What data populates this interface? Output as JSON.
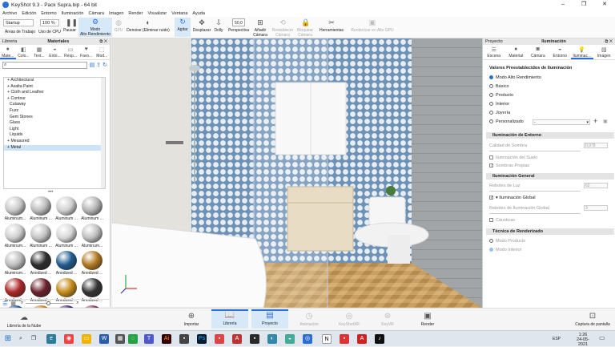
{
  "window": {
    "title": "KeyShot 9.3 - Pack Supra.bip - 64 bit"
  },
  "menu": [
    "Archivo",
    "Edición",
    "Entorno",
    "Iluminación",
    "Cámara",
    "Imagen",
    "Render",
    "Visualizar",
    "Ventana",
    "Ayuda"
  ],
  "toolbar": {
    "workspace": "Startup",
    "zoom": "100 %",
    "workspace_label": "Áreas de Trabajo",
    "cpu_label": "Uso de CPU",
    "pause_label": "Pausar",
    "modo_label": "Modo\nAlto Rendimiento",
    "gpu_label": "GPU",
    "denoise_label": "Denoise (Eliminar ruido)",
    "agitar_label": "Agitar",
    "desplazar_label": "Desplazar",
    "dolly_label": "Dolly",
    "perspective_value": "50,0",
    "perspective_label": "Perspectiva",
    "add_camera_label": "Añadir\nCámara",
    "reset_camera_label": "Restablecer\nCámara",
    "lock_camera_label": "Bloquear\nCámara",
    "tools_label": "Herramientas",
    "render_hp_label": "Renderizar en Alto GPU"
  },
  "library": {
    "panel_title": "Libreria",
    "section_title": "Materiales",
    "tabs": [
      "Mate...",
      "Colo...",
      "Text...",
      "Ento...",
      "Resp...",
      "Favo...",
      "Mod..."
    ],
    "tree": [
      "Architectural",
      "Axalta Paint",
      "Cloth and Leather",
      "Contour",
      "Cutaway",
      "Fuzz",
      "Gem Stones",
      "Glass",
      "Light",
      "Liquids",
      "Measured",
      "Metal"
    ],
    "selected": "Metal",
    "tiles": [
      {
        "label": "Aluminum...",
        "color": "#c9c9c9"
      },
      {
        "label": "Aluminum ...",
        "color": "#bcbcbc"
      },
      {
        "label": "Aluminum ...",
        "color": "#d0d0d0"
      },
      {
        "label": "Aluminum ...",
        "color": "#b5b5b5"
      },
      {
        "label": "Aluminum...",
        "color": "#cfcfcf"
      },
      {
        "label": "Aluminum ...",
        "color": "#c5c5c5"
      },
      {
        "label": "Aluminum ...",
        "color": "#d8d8d8"
      },
      {
        "label": "Aluminum...",
        "color": "#c0c0c0"
      },
      {
        "label": "Aluminum...",
        "color": "#bdbdbd"
      },
      {
        "label": "Anodized ...",
        "color": "#2b2b2b"
      },
      {
        "label": "Anodized ...",
        "color": "#1f5b8f"
      },
      {
        "label": "Anodized ...",
        "color": "#b07820"
      },
      {
        "label": "Anodized ...",
        "color": "#aa2626"
      },
      {
        "label": "Anodized ...",
        "color": "#6a1f2a"
      },
      {
        "label": "Anodized ...",
        "color": "#c48a18"
      },
      {
        "label": "Anodized ...",
        "color": "#333333"
      },
      {
        "label": "",
        "color": "#1a4e9a"
      },
      {
        "label": "",
        "color": "#c07818"
      },
      {
        "label": "",
        "color": "#3e1f6e"
      },
      {
        "label": "",
        "color": "#7a2f5a"
      }
    ]
  },
  "properties": {
    "panel_title": "Proyecto",
    "section_title": "Iluminación",
    "tabs": [
      "Escena",
      "Material",
      "Cámara",
      "Entorno",
      "Iluminac...",
      "Imagen"
    ],
    "presets_title": "Valores Preestablecidos de Iluminación",
    "presets": [
      "Modo Alto Rendimiento",
      "Básico",
      "Producto",
      "Interior",
      "Joyería",
      "Personalizado"
    ],
    "presets_selected": "Modo Alto Rendimiento",
    "entorno_title": "Iluminación de Entorno",
    "calidad_label": "Calidad de Sombra",
    "calidad_value": "0,978",
    "suelo_label": "Iluminación del Suelo",
    "sombras_label": "Sombras Propias",
    "general_title": "Iluminación General",
    "rebotes_label": "Rebotes de Luz",
    "rebotes_value": "62",
    "global_label": "Iluminación Global",
    "rebotes_global_label": "Rebotes de Iluminación Global",
    "rebotes_global_value": "3",
    "causticas_label": "Cáusticas",
    "tecnica_title": "Técnica de Renderizado",
    "tecnicas": [
      "Modo Producto",
      "Modo Interior"
    ]
  },
  "bottom": {
    "nube_label": "Librería de la Nube",
    "importar": "Importar",
    "libreria": "Librería",
    "proyecto": "Proyecto",
    "animacion": "Animación",
    "keyshotxr": "KeyShotXR",
    "keyvr": "KeyVR",
    "render": "Render",
    "captura": "Captura de pantalla"
  },
  "taskbar": {
    "time": "1:26",
    "date": "24-05-2021",
    "lang": "ESP"
  }
}
